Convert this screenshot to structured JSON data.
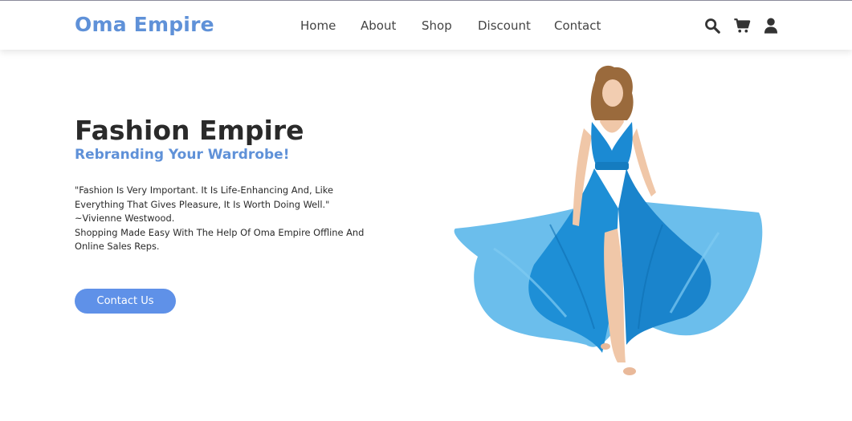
{
  "header": {
    "logo": "Oma Empire",
    "nav": [
      {
        "label": "Home"
      },
      {
        "label": "About"
      },
      {
        "label": "Shop"
      },
      {
        "label": "Discount"
      },
      {
        "label": "Contact"
      }
    ],
    "icons": [
      "search-icon",
      "cart-icon",
      "user-icon"
    ]
  },
  "hero": {
    "title": "Fashion Empire",
    "subtitle": "Rebranding Your Wardrobe!",
    "text_lines": [
      "\"Fashion Is Very Important. It Is Life-Enhancing And, Like",
      "Everything That Gives Pleasure, It Is Worth Doing Well.\"",
      "~Vivienne Westwood.",
      "Shopping Made Easy With The Help Of Oma Empire Offline And",
      "Online Sales Reps."
    ],
    "button_label": "Contact Us"
  },
  "colors": {
    "accent": "#5f91d8",
    "button": "#5f91e8",
    "dress": "#1e8fd6",
    "text": "#2a2a2a"
  }
}
